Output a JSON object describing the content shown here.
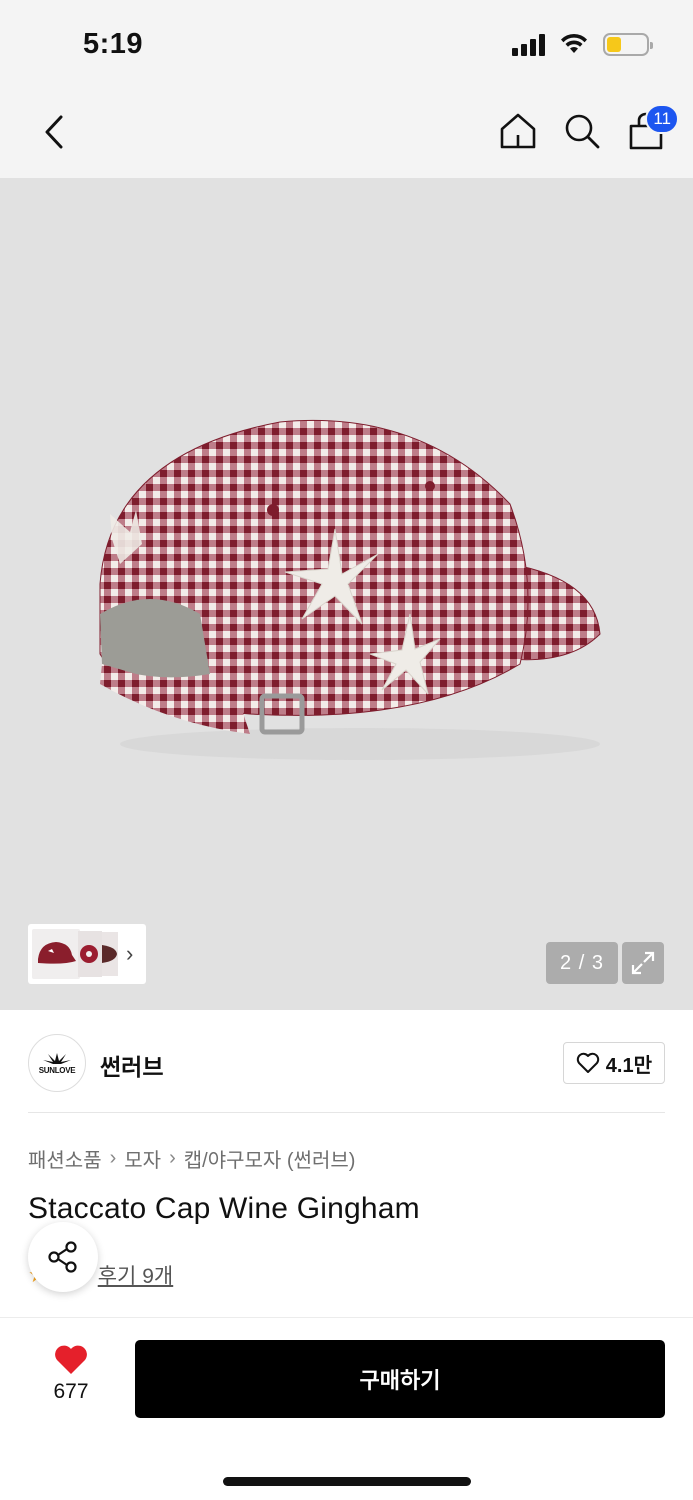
{
  "status_bar": {
    "time": "5:19"
  },
  "nav": {
    "cart_count": "11"
  },
  "gallery": {
    "page_counter": "2 / 3",
    "current_page": 2,
    "total_pages": 3
  },
  "brand": {
    "logo_text": "SUNLOVE",
    "name": "썬러브",
    "like_count": "4.1만"
  },
  "breadcrumb": [
    "패션소품",
    "모자",
    "캡/야구모자 (썬러브)"
  ],
  "product": {
    "title": "Staccato Cap Wine Gingham",
    "review_label": "후기 9개"
  },
  "bottom_bar": {
    "wish_count": "677",
    "buy_label": "구매하기"
  },
  "colors": {
    "accent_blue": "#1d56f0",
    "heart_red": "#e5202b",
    "cap_wine": "#8a1e2c",
    "buy_button": "#000000"
  },
  "icons": [
    "back-icon",
    "home-icon",
    "search-icon",
    "bag-icon",
    "expand-icon",
    "heart-outline-icon",
    "star-icon",
    "share-icon",
    "heart-filled-icon"
  ]
}
